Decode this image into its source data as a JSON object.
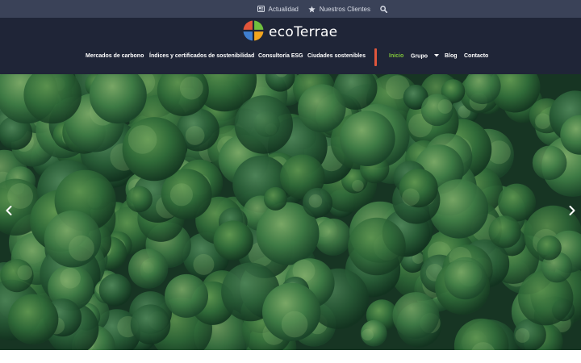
{
  "topbar": {
    "news_label": "Actualidad",
    "clients_label": "Nuestros Clientes",
    "news_icon": "newspaper-icon",
    "clients_icon": "star-icon",
    "search_icon": "search-icon"
  },
  "logo": {
    "text": "ecoTerrae",
    "quadrant_colors": [
      "#e2553a",
      "#6fbf3e",
      "#3f7fd0",
      "#f2a51e"
    ]
  },
  "nav": {
    "items": [
      {
        "label": "Mercados de carbono"
      },
      {
        "label": "Índices y certificados de sostenibilidad"
      },
      {
        "label": "Consultoría ESG"
      },
      {
        "label": "Ciudades sostenibles"
      },
      {
        "label": "Inicio",
        "active": true
      },
      {
        "label": "Grupo",
        "dropdown": true
      },
      {
        "label": "Blog"
      },
      {
        "label": "Contacto"
      }
    ]
  },
  "hero": {
    "image": "aerial forest canopy",
    "prev_icon": "chevron-left-icon",
    "next_icon": "chevron-right-icon"
  },
  "colors": {
    "topbar_bg": "#3a4258",
    "header_bg": "#1f2537",
    "active_nav": "#7fc43a",
    "divider": "#e0563c"
  }
}
